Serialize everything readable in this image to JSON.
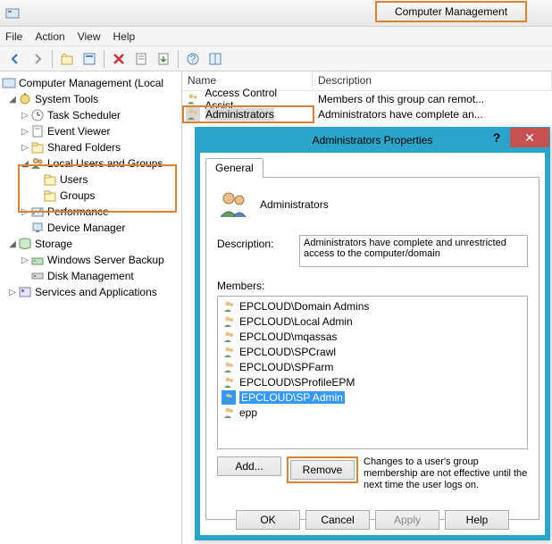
{
  "window": {
    "title": "Computer Management"
  },
  "menu": {
    "file": "File",
    "action": "Action",
    "view": "View",
    "help": "Help"
  },
  "tree": {
    "root": "Computer Management (Local",
    "system_tools": "System Tools",
    "task_scheduler": "Task Scheduler",
    "event_viewer": "Event Viewer",
    "shared_folders": "Shared Folders",
    "local_users_groups": "Local Users and Groups",
    "users": "Users",
    "groups": "Groups",
    "performance": "Performance",
    "device_manager": "Device Manager",
    "storage": "Storage",
    "wsb": "Windows Server Backup",
    "disk_mgmt": "Disk Management",
    "services_apps": "Services and Applications"
  },
  "list": {
    "col_name": "Name",
    "col_desc": "Description",
    "rows": [
      {
        "name": "Access Control Assist...",
        "desc": "Members of this group can remot..."
      },
      {
        "name": "Administrators",
        "desc": "Administrators have complete an..."
      }
    ]
  },
  "dialog": {
    "title": "Administrators Properties",
    "tab_general": "General",
    "group_name": "Administrators",
    "desc_label": "Description:",
    "desc_value": "Administrators have complete and unrestricted access to the computer/domain",
    "members_label": "Members:",
    "members": [
      "EPCLOUD\\Domain Admins",
      "EPCLOUD\\Local Admin",
      "EPCLOUD\\mqassas",
      "EPCLOUD\\SPCrawl",
      "EPCLOUD\\SPFarm",
      "EPCLOUD\\SProfileEPM",
      "EPCLOUD\\SP Admin",
      "epp"
    ],
    "selected_index": 6,
    "add": "Add...",
    "remove": "Remove",
    "note": "Changes to a user's group membership are not effective until the next time the user logs on.",
    "ok": "OK",
    "cancel": "Cancel",
    "apply": "Apply",
    "help": "Help"
  }
}
